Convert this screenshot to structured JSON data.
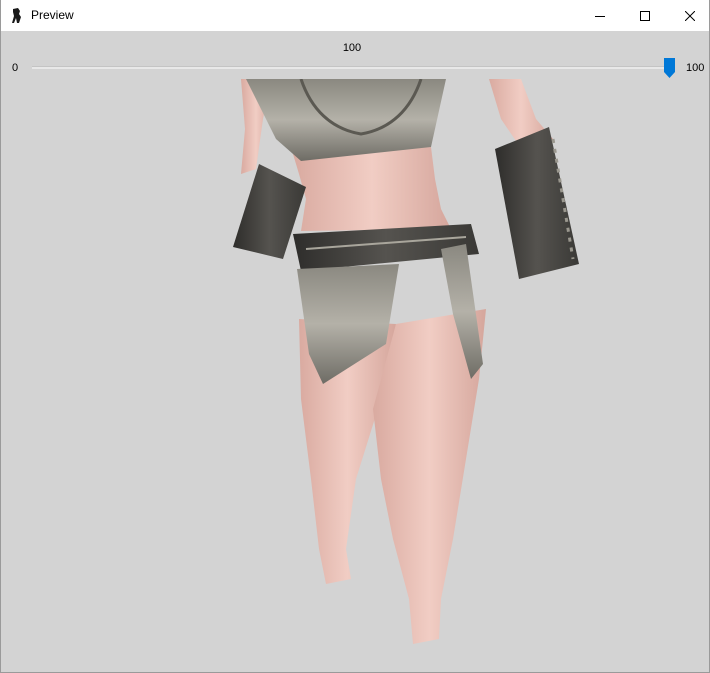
{
  "window": {
    "title": "Preview",
    "controls": {
      "minimize": "minimize-icon",
      "maximize": "maximize-icon",
      "close": "close-icon"
    }
  },
  "slider": {
    "value": "100",
    "min_label": "0",
    "max_label": "100",
    "level": 1.0,
    "thumb_color": "#0078d7"
  },
  "viewport": {
    "content": "3d-model-preview",
    "background": "#d3d3d3"
  }
}
